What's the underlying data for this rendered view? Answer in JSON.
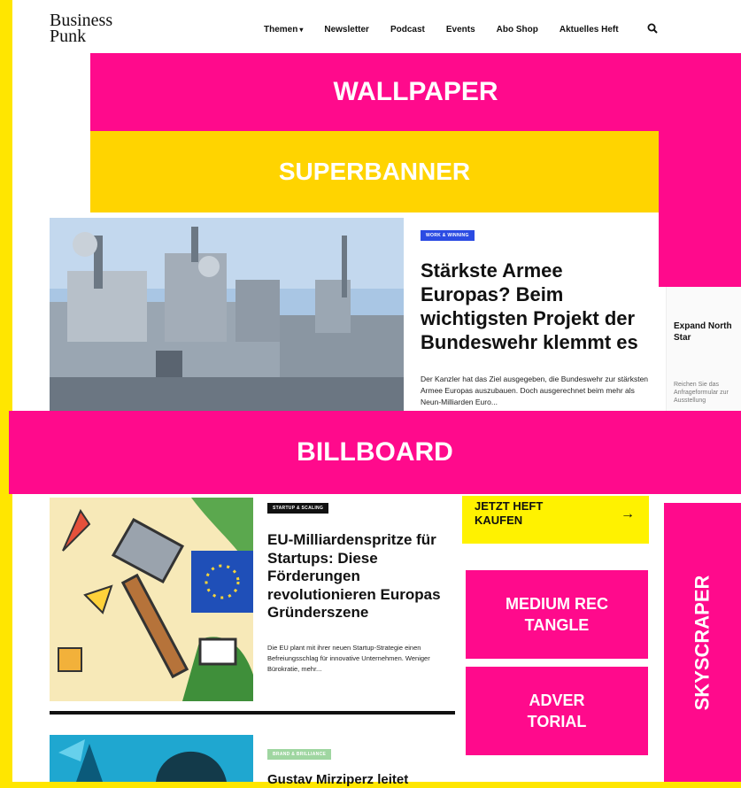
{
  "logo": {
    "line1": "Business",
    "line2": "Punk"
  },
  "nav": {
    "items": [
      "Themen",
      "Newsletter",
      "Podcast",
      "Events",
      "Abo Shop",
      "Aktuelles Heft"
    ],
    "dropdown_caret": "▾",
    "search_icon": "search-icon"
  },
  "ads": {
    "wallpaper": "WALLPAPER",
    "superbanner": "SUPERBANNER",
    "billboard": "BILLBOARD",
    "medium_rectangle_line1": "MEDIUM REC",
    "medium_rectangle_line2": "TANGLE",
    "advertorial_line1": "ADVER",
    "advertorial_line2": "TORIAL",
    "skyscraper": "SKYSCRAPER"
  },
  "hero": {
    "tag": "WORK & WINNING",
    "title": "Stärkste Armee Europas? Beim wichtigsten Projekt der Bundeswehr klemmt es",
    "excerpt": "Der Kanzler hat das Ziel ausgegeben, die Bundeswehr zur stärksten Armee Europas auszubauen. Doch ausgerechnet beim mehr als Neun-Milliarden Euro..."
  },
  "teaser": {
    "title": "Expand North Star",
    "text": "Reichen Sie das Anfrageformular zur Ausstellung"
  },
  "article2": {
    "tag": "STARTUP & SCALING",
    "title": "EU-Milliardenspritze für Startups: Diese Förderungen revolutionieren Europas Gründerszene",
    "excerpt": "Die EU plant mit ihrer neuen Startup-Strategie einen Befreiungsschlag für innovative Unternehmen. Weniger Bürokratie, mehr..."
  },
  "article3": {
    "tag": "BRAND & BRILLIANCE",
    "title": "Gustav Mirziperz leitet"
  },
  "sidebar": {
    "buy_label": "JETZT HEFT KAUFEN",
    "buy_arrow": "→"
  },
  "colors": {
    "frame_yellow": "#ffe600",
    "ad_pink": "#ff0a8c",
    "ad_yellow": "#ffd400",
    "buy_yellow": "#fff200",
    "tag_blue": "#2b4be3"
  }
}
